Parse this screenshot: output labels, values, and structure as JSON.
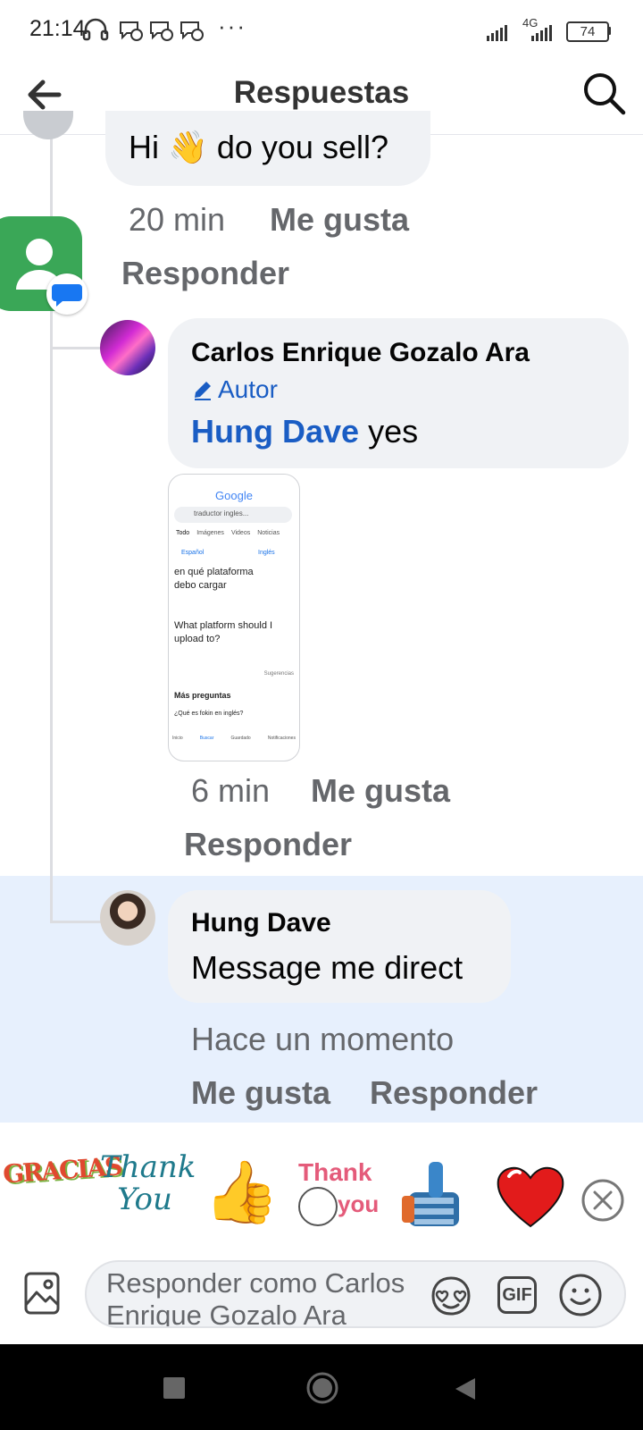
{
  "status_bar": {
    "time": "21:14",
    "left_icons": [
      "headphones-icon",
      "messenger-icon",
      "messenger-icon",
      "messenger-icon"
    ],
    "overflow": "···",
    "network": "4G",
    "battery": "74"
  },
  "header": {
    "title": "Respuestas",
    "back_icon": "arrow-left-icon",
    "search_icon": "search-icon"
  },
  "comments": [
    {
      "text_before_emoji": "Hi",
      "emoji": "👋",
      "text_after_emoji": "do you sell?",
      "time": "20 min",
      "like": "Me gusta",
      "reply": "Responder"
    },
    {
      "author": "Carlos Enrique Gozalo Ara",
      "badge": "Autor",
      "mention": "Hung Dave",
      "text": "yes",
      "time": "6 min",
      "like": "Me gusta",
      "reply": "Responder",
      "attachment": {
        "logo": "Google",
        "search_query": "traductor ingles...",
        "tabs": [
          "Todo",
          "Imágenes",
          "Videos",
          "Noticias"
        ],
        "lang_from": "Español",
        "lang_to": "Inglés",
        "source_text": "en qué plataforma debo cargar",
        "translated_text": "What platform should I upload to?",
        "suggestions_label": "Sugerencias",
        "more_questions": "Más preguntas",
        "question": "¿Qué es fokin en inglés?",
        "nav": [
          "Inicio",
          "Buscar",
          "Guardado",
          "Notificaciones"
        ]
      }
    },
    {
      "author": "Hung Dave",
      "text": "Message me direct",
      "time": "Hace un momento",
      "like": "Me gusta",
      "reply": "Responder"
    }
  ],
  "stickers": {
    "gracias": "GRACIAS",
    "thank_you_script_1": "Thank",
    "thank_you_script_2": "You",
    "thumbs_emoji": "👍",
    "thank_you_pink_1": "Thank",
    "thank_you_pink_2": "you",
    "robot_hand_icon": "robot-thumbs-up-icon",
    "heart_emoji": "❤",
    "close_icon": "close-circle-icon"
  },
  "composer": {
    "placeholder": "Responder como Carlos Enrique Gozalo Ara",
    "photo_icon": "image-icon",
    "avatar_sticker_icon": "avatar-sticker-icon",
    "gif_label": "GIF",
    "emoji_icon": "smiley-icon"
  },
  "nav_bar": {
    "recent_icon": "square-icon",
    "home_icon": "circle-icon",
    "back_icon": "triangle-back-icon"
  },
  "colors": {
    "accent_blue": "#1877f2",
    "mention_blue": "#1a5dc4",
    "highlight_bg": "#e7f0fd",
    "bubble_bg": "#f0f2f5",
    "meta_gray": "#65676b"
  }
}
